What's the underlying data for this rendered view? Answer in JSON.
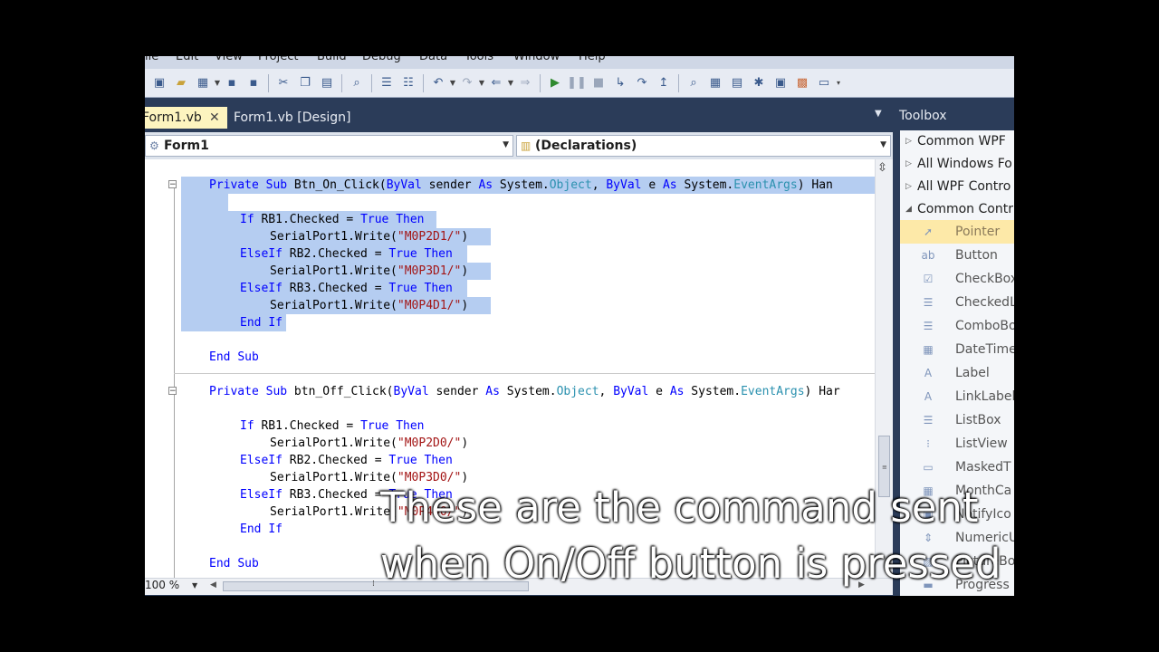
{
  "menu": [
    "ile",
    "Edit",
    "View",
    "Project",
    "Build",
    "Debug",
    "Data",
    "Tools",
    "Window",
    "Help"
  ],
  "tabs": [
    {
      "label": "Form1.vb",
      "active": true
    },
    {
      "label": "Form1.vb [Design]",
      "active": false
    }
  ],
  "nav": {
    "left": "Form1",
    "right": "(Declarations)"
  },
  "code": {
    "sub1_sig": [
      "Private",
      " ",
      "Sub",
      " Btn_On_Click(",
      "ByVal",
      " sender ",
      "As",
      " System.",
      "Object",
      ", ",
      "ByVal",
      " e ",
      "As",
      " System.",
      "EventArgs",
      ") Han"
    ],
    "if1": [
      "If",
      " RB1.Checked = ",
      "True",
      " ",
      "Then"
    ],
    "write1": [
      "SerialPort1.Write(",
      "\"M0P2D1/\"",
      ")"
    ],
    "elseif1": [
      "ElseIf",
      " RB2.Checked = ",
      "True",
      " ",
      "Then"
    ],
    "write2": [
      "SerialPort1.Write(",
      "\"M0P3D1/\"",
      ")"
    ],
    "elseif2": [
      "ElseIf",
      " RB3.Checked = ",
      "True",
      " ",
      "Then"
    ],
    "write3": [
      "SerialPort1.Write(",
      "\"M0P4D1/\"",
      ")"
    ],
    "endif": [
      "End",
      " ",
      "If"
    ],
    "endsub": [
      "End",
      " ",
      "Sub"
    ],
    "sub2_sig": [
      "Private",
      " ",
      "Sub",
      " btn_Off_Click(",
      "ByVal",
      " sender ",
      "As",
      " System.",
      "Object",
      ", ",
      "ByVal",
      " e ",
      "As",
      " System.",
      "EventArgs",
      ") Har"
    ],
    "write4": [
      "SerialPort1.Write(",
      "\"M0P2D0/\"",
      ")"
    ],
    "write5": [
      "SerialPort1.Write(",
      "\"M0P3D0/\"",
      ")"
    ],
    "write6": [
      "SerialPort1.Write(",
      "\"M0P4D0/\"",
      ")"
    ]
  },
  "zoom": "100 %",
  "toolbox": {
    "title": "Toolbox",
    "categories": [
      {
        "label": "Common WPF",
        "expanded": false
      },
      {
        "label": "All Windows Fo",
        "expanded": false
      },
      {
        "label": "All WPF Contro",
        "expanded": false
      },
      {
        "label": "Common Contr",
        "expanded": true
      }
    ],
    "items": [
      {
        "label": "Pointer",
        "icon": "pointer-icon",
        "glyph": "➚"
      },
      {
        "label": "Button",
        "icon": "button-icon",
        "glyph": "ab"
      },
      {
        "label": "CheckBox",
        "icon": "checkbox-icon",
        "glyph": "☑"
      },
      {
        "label": "CheckedL",
        "icon": "checkedlistbox-icon",
        "glyph": "☰"
      },
      {
        "label": "ComboBo",
        "icon": "combobox-icon",
        "glyph": "☰"
      },
      {
        "label": "DateTime",
        "icon": "datetime-icon",
        "glyph": "▦"
      },
      {
        "label": "Label",
        "icon": "label-icon",
        "glyph": "A"
      },
      {
        "label": "LinkLabel",
        "icon": "linklabel-icon",
        "glyph": "A"
      },
      {
        "label": "ListBox",
        "icon": "listbox-icon",
        "glyph": "☰"
      },
      {
        "label": "ListView",
        "icon": "listview-icon",
        "glyph": "⁝"
      },
      {
        "label": "MaskedT",
        "icon": "maskedtextbox-icon",
        "glyph": "▭"
      },
      {
        "label": "MonthCa",
        "icon": "monthcalendar-icon",
        "glyph": "▦"
      },
      {
        "label": "NotifyIco",
        "icon": "notifyicon-icon",
        "glyph": "▣"
      },
      {
        "label": "NumericU",
        "icon": "numericupdown-icon",
        "glyph": "⇕"
      },
      {
        "label": "PictureBo",
        "icon": "picturebox-icon",
        "glyph": "▨"
      },
      {
        "label": "Progress",
        "icon": "progressbar-icon",
        "glyph": "▬"
      }
    ]
  },
  "subtitle": {
    "line1": "These are the command sent",
    "line2": "when On/Off button is pressed"
  }
}
